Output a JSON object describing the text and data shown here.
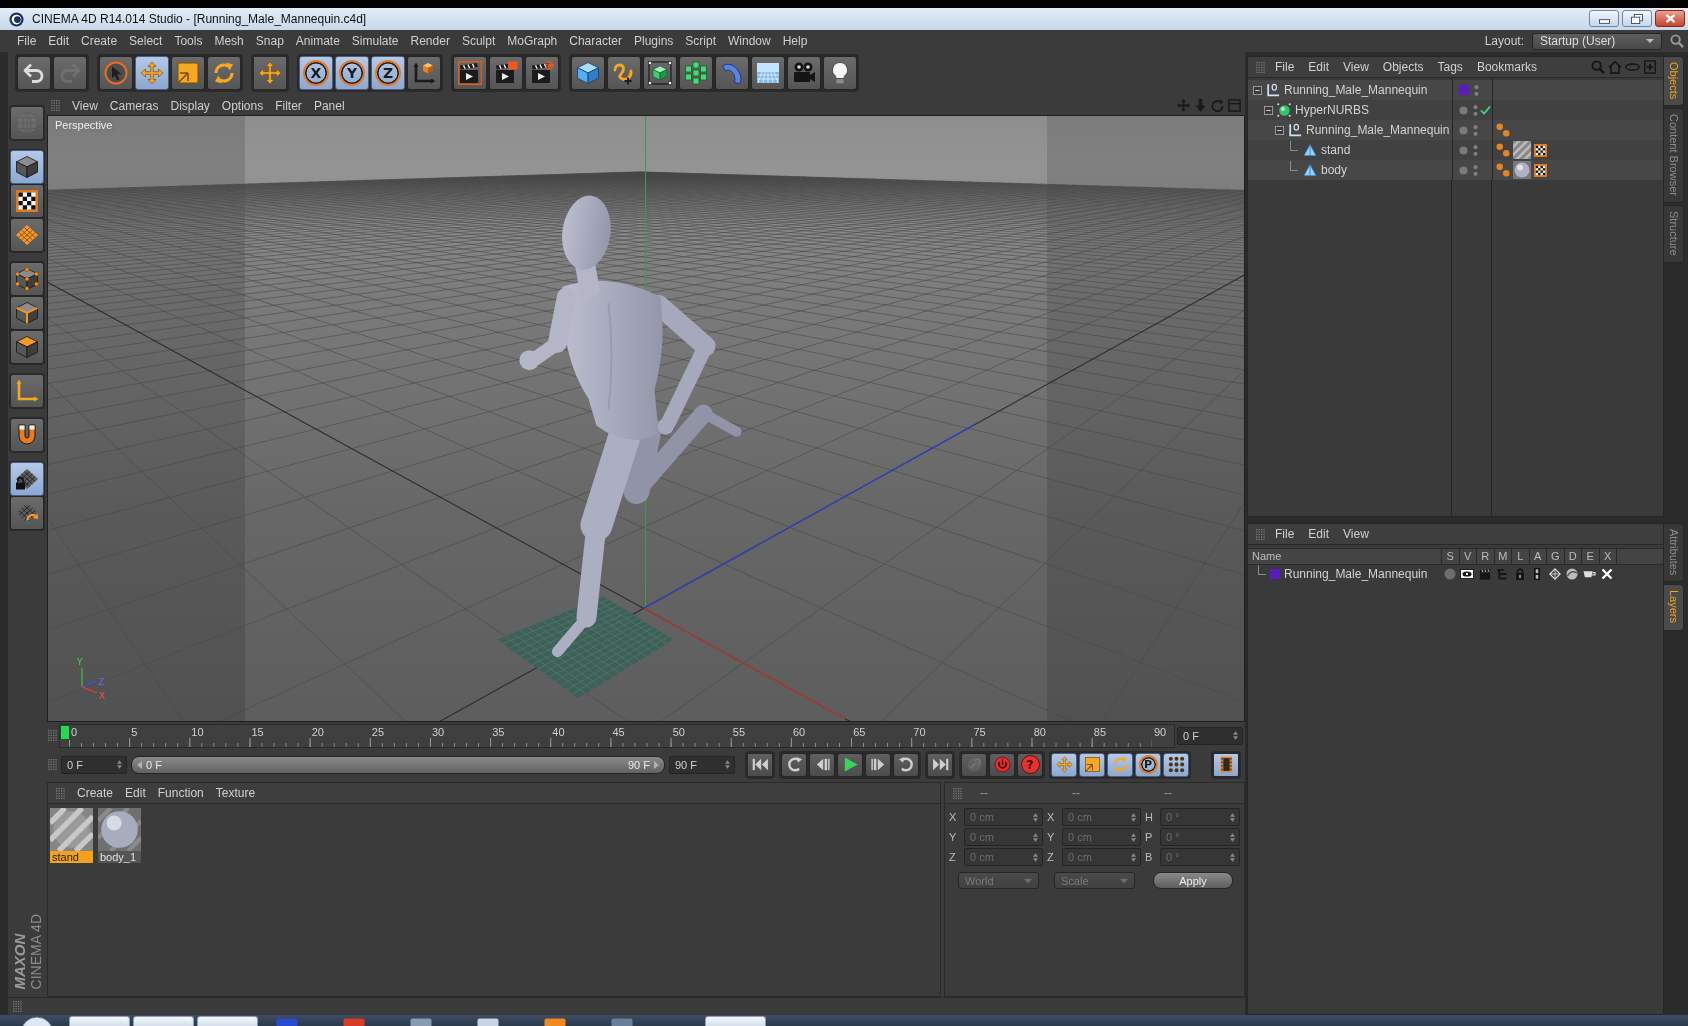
{
  "window": {
    "title": "CINEMA 4D R14.014 Studio - [Running_Male_Mannequin.c4d]"
  },
  "menu_bar": {
    "items": [
      "File",
      "Edit",
      "Create",
      "Select",
      "Tools",
      "Mesh",
      "Snap",
      "Animate",
      "Simulate",
      "Render",
      "Sculpt",
      "MoGraph",
      "Character",
      "Plugins",
      "Script",
      "Window",
      "Help"
    ],
    "layout_label": "Layout:",
    "layout_value": "Startup (User)"
  },
  "toolbar": [
    [
      {
        "kind": "undo",
        "disabled": false
      },
      {
        "kind": "redo",
        "disabled": true
      }
    ],
    [
      {
        "kind": "live-select",
        "on": false
      },
      {
        "kind": "move",
        "on": true
      },
      {
        "kind": "scale",
        "on": false
      },
      {
        "kind": "rotate",
        "on": false
      }
    ],
    [
      {
        "kind": "last-tool",
        "on": false
      }
    ],
    [
      {
        "kind": "axis-lock",
        "label": "X",
        "on": true
      },
      {
        "kind": "axis-lock",
        "label": "Y",
        "on": true
      },
      {
        "kind": "axis-lock",
        "label": "Z",
        "on": true
      },
      {
        "kind": "coordinate-system",
        "on": false
      }
    ],
    [
      {
        "kind": "render-view"
      },
      {
        "kind": "render-picture-viewer"
      },
      {
        "kind": "render-settings"
      }
    ],
    [
      {
        "kind": "cube"
      },
      {
        "kind": "pen"
      },
      {
        "kind": "subdivision"
      },
      {
        "kind": "cloner"
      },
      {
        "kind": "deformer"
      },
      {
        "kind": "floor"
      },
      {
        "kind": "camera"
      },
      {
        "kind": "light"
      }
    ]
  ],
  "left_toolbar": [
    [
      {
        "kind": "render-mode",
        "disabled": true
      }
    ],
    [
      {
        "kind": "model",
        "on": true
      },
      {
        "kind": "texture",
        "on": false
      },
      {
        "kind": "workplane",
        "on": false
      }
    ],
    [
      {
        "kind": "points",
        "on": false
      },
      {
        "kind": "edges",
        "on": false
      },
      {
        "kind": "polygons",
        "on": false
      }
    ],
    [
      {
        "kind": "axis",
        "on": false
      }
    ],
    [
      {
        "kind": "snap",
        "on": false
      }
    ],
    [
      {
        "kind": "lock-workplane",
        "on": true
      },
      {
        "kind": "planar-workplane",
        "on": false
      }
    ]
  ],
  "logo": {
    "brand": "MAXON",
    "product": "CINEMA 4D"
  },
  "viewport": {
    "menu": [
      "View",
      "Cameras",
      "Display",
      "Options",
      "Filter",
      "Panel"
    ],
    "camera": "Perspective",
    "axis_labels": {
      "y": "Y",
      "z": "Z",
      "x": "X"
    }
  },
  "timeline": {
    "labels": [
      "0",
      "5",
      "10",
      "15",
      "20",
      "25",
      "30",
      "35",
      "40",
      "45",
      "50",
      "55",
      "60",
      "65",
      "70",
      "75",
      "80",
      "85",
      "90"
    ],
    "level": 0,
    "frame": "0 F"
  },
  "transport": {
    "start": "0 F",
    "range_start": "0 F",
    "range_end": "90 F",
    "end": "90 F",
    "playback": [
      [
        {
          "kind": "go-start"
        }
      ],
      [
        {
          "kind": "prev-key"
        },
        {
          "kind": "prev-frame"
        },
        {
          "kind": "play"
        },
        {
          "kind": "next-frame"
        },
        {
          "kind": "next-key"
        }
      ],
      [
        {
          "kind": "go-end"
        }
      ]
    ],
    "record": [
      {
        "kind": "autokey",
        "disabled": true
      },
      {
        "kind": "record",
        "disabled": false
      },
      {
        "kind": "key-help",
        "label": "?",
        "disabled": false
      }
    ],
    "keys": [
      {
        "kind": "position",
        "on": true
      },
      {
        "kind": "scale",
        "on": true
      },
      {
        "kind": "rotation",
        "on": true
      },
      {
        "kind": "parameter",
        "label": "P",
        "on": true
      },
      {
        "kind": "point-level",
        "on": true
      }
    ],
    "timeline_button": {
      "on": true
    }
  },
  "materials": {
    "menu": [
      "Create",
      "Edit",
      "Function",
      "Texture"
    ],
    "items": [
      {
        "name": "stand",
        "kind": "striped",
        "selected": true
      },
      {
        "name": "body_1",
        "kind": "sphere",
        "selected": false
      }
    ]
  },
  "coordinates": {
    "headers": [
      "--",
      "--",
      "--"
    ],
    "disabled": true,
    "rows": [
      {
        "position_axis": "X",
        "position": "0 cm",
        "size_axis": "X",
        "size": "0 cm",
        "rotation_axis": "H",
        "rotation": "0 °"
      },
      {
        "position_axis": "Y",
        "position": "0 cm",
        "size_axis": "Y",
        "size": "0 cm",
        "rotation_axis": "P",
        "rotation": "0 °"
      },
      {
        "position_axis": "Z",
        "position": "0 cm",
        "size_axis": "Z",
        "size": "0 cm",
        "rotation_axis": "B",
        "rotation": "0 °"
      }
    ],
    "mode": "World",
    "size_mode": "Scale",
    "apply": "Apply"
  },
  "objects": {
    "menu": [
      "File",
      "Edit",
      "View",
      "Objects",
      "Tags",
      "Bookmarks"
    ],
    "tree": [
      {
        "name": "Running_Male_Mannequin",
        "kind": "null",
        "expanded": true,
        "color": "#5a1bbf",
        "children": [
          {
            "name": "HyperNURBS",
            "kind": "subdivision",
            "expanded": true,
            "enabled": true,
            "children": [
              {
                "name": "Running_Male_Mannequin",
                "kind": "null",
                "expanded": true,
                "tags": [
                  {
                    "kind": "phong"
                  }
                ],
                "children": [
                  {
                    "name": "stand",
                    "kind": "polygon",
                    "tags": [
                      {
                        "kind": "phong"
                      },
                      {
                        "kind": "material-striped"
                      },
                      {
                        "kind": "uvw"
                      }
                    ]
                  },
                  {
                    "name": "body",
                    "kind": "polygon",
                    "tags": [
                      {
                        "kind": "phong"
                      },
                      {
                        "kind": "material-sphere"
                      },
                      {
                        "kind": "uvw"
                      }
                    ]
                  }
                ]
              }
            ]
          }
        ]
      }
    ]
  },
  "layers": {
    "menu": [
      "File",
      "Edit",
      "View"
    ],
    "columns": [
      "Name",
      "S",
      "V",
      "R",
      "M",
      "L",
      "A",
      "G",
      "D",
      "E",
      "X"
    ],
    "rows": [
      {
        "name": "Running_Male_Mannequin",
        "color": "#5a1bbf"
      }
    ]
  },
  "side_tabs": [
    [
      {
        "label": "Objects",
        "selected": true
      },
      {
        "label": "Content Browser",
        "selected": false
      },
      {
        "label": "Structure",
        "selected": false
      }
    ],
    [
      {
        "label": "Attributes",
        "selected": false
      },
      {
        "label": "Layers",
        "selected": true
      }
    ]
  ]
}
